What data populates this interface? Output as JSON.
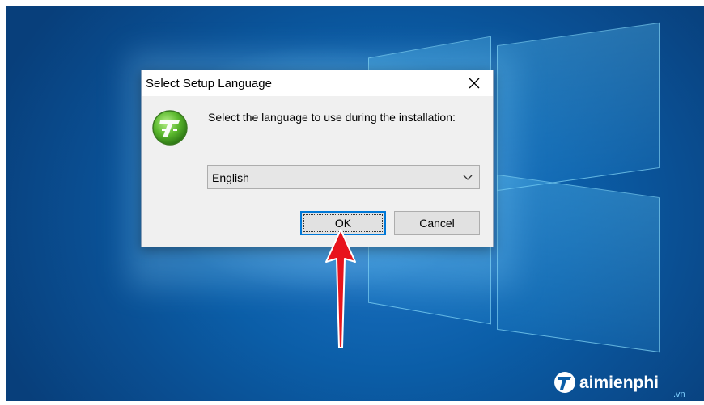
{
  "dialog": {
    "title": "Select Setup Language",
    "prompt": "Select the language to use during the installation:",
    "language_value": "English",
    "ok_label": "OK",
    "cancel_label": "Cancel"
  },
  "watermark": {
    "logo_text": "aimienphi",
    "sub": ".vn"
  },
  "icons": [
    "close-icon",
    "setup-app-icon",
    "chevron-down-icon",
    "red-arrow-icon"
  ],
  "colors": {
    "accent_focus": "#0078d7",
    "arrow": "#e8141c",
    "desktop": "#0b5ea8"
  }
}
